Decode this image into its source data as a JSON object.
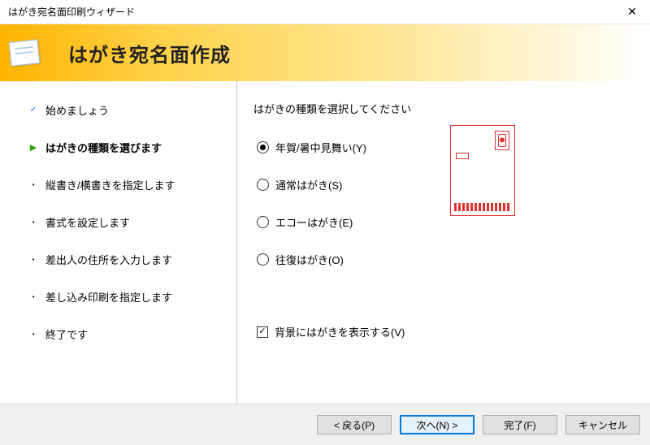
{
  "window": {
    "title": "はがき宛名面印刷ウィザード"
  },
  "header": {
    "title": "はがき宛名面作成"
  },
  "steps": [
    {
      "label": "始めましょう",
      "state": "done"
    },
    {
      "label": "はがきの種類を選びます",
      "state": "current"
    },
    {
      "label": "縦書き/横書きを指定します",
      "state": "pending"
    },
    {
      "label": "書式を設定します",
      "state": "pending"
    },
    {
      "label": "差出人の住所を入力します",
      "state": "pending"
    },
    {
      "label": "差し込み印刷を指定します",
      "state": "pending"
    },
    {
      "label": "終了です",
      "state": "pending"
    }
  ],
  "content": {
    "heading": "はがきの種類を選択してください",
    "options": [
      {
        "label": "年賀/暑中見舞い(Y)",
        "selected": true
      },
      {
        "label": "通常はがき(S)",
        "selected": false
      },
      {
        "label": "エコーはがき(E)",
        "selected": false
      },
      {
        "label": "往復はがき(O)",
        "selected": false
      }
    ],
    "show_background": {
      "label": "背景にはがきを表示する(V)",
      "checked": true,
      "checkmark": "✓"
    }
  },
  "buttons": {
    "back": "< 戻る(P)",
    "next": "次へ(N) >",
    "finish": "完了(F)",
    "cancel": "キャンセル"
  }
}
